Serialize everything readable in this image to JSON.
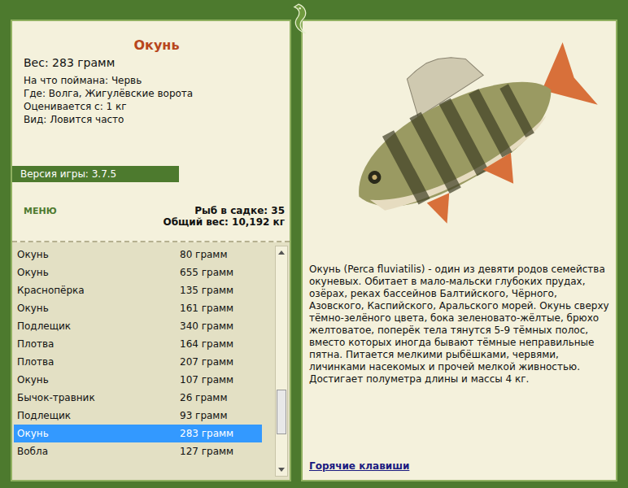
{
  "fish_card": {
    "name": "Окунь",
    "weight": "Вес: 283 грамм",
    "details": [
      "На что поймана: Червь",
      "Где: Волга, Жигулёвские ворота",
      "Оценивается с: 1 кг",
      "Вид: Ловится часто"
    ]
  },
  "version": "Версия игры: 3.7.5",
  "menu_button": "МЕНЮ",
  "stats": [
    "Рыб в садке: 35",
    "Общий вес: 10,192 кг"
  ],
  "catch_list": [
    {
      "name": "Окунь",
      "weight": "80 грамм",
      "selected": false
    },
    {
      "name": "Окунь",
      "weight": "655 грамм",
      "selected": false
    },
    {
      "name": "Краснопёрка",
      "weight": "135 грамм",
      "selected": false
    },
    {
      "name": "Окунь",
      "weight": "161 грамм",
      "selected": false
    },
    {
      "name": "Подлещик",
      "weight": "340 грамм",
      "selected": false
    },
    {
      "name": "Плотва",
      "weight": "164 грамм",
      "selected": false
    },
    {
      "name": "Плотва",
      "weight": "207 грамм",
      "selected": false
    },
    {
      "name": "Окунь",
      "weight": "107 грамм",
      "selected": false
    },
    {
      "name": "Бычок-травник",
      "weight": "26 грамм",
      "selected": false
    },
    {
      "name": "Подлещик",
      "weight": "93 грамм",
      "selected": false
    },
    {
      "name": "Окунь",
      "weight": "283 грамм",
      "selected": true
    },
    {
      "name": "Вобла",
      "weight": "127 грамм",
      "selected": false
    }
  ],
  "scrollbar": {
    "level": 0.82
  },
  "description": "Окунь (Perca fluviatilis) - один из девяти родов семейства окуневых. Обитает в мало-мальски глубоких прудах, озёрах, реках бассейнов Балтийского, Чёрного, Азовского, Каспийского, Аральского морей. Окунь сверху тёмно-зелёного цвета, бока зеленовато-жёлтые, брюхо желтоватое, поперёк тела тянутся 5-9 тёмных полос, вместо которых иногда бывают тёмные неправильные пятна. Питается мелкими рыбёшками, червями, личинками насекомых и прочей мелкой живностью. Достигает полуметра длины и массы 4 кг.",
  "hotkeys_link": "Горячие клавиши"
}
